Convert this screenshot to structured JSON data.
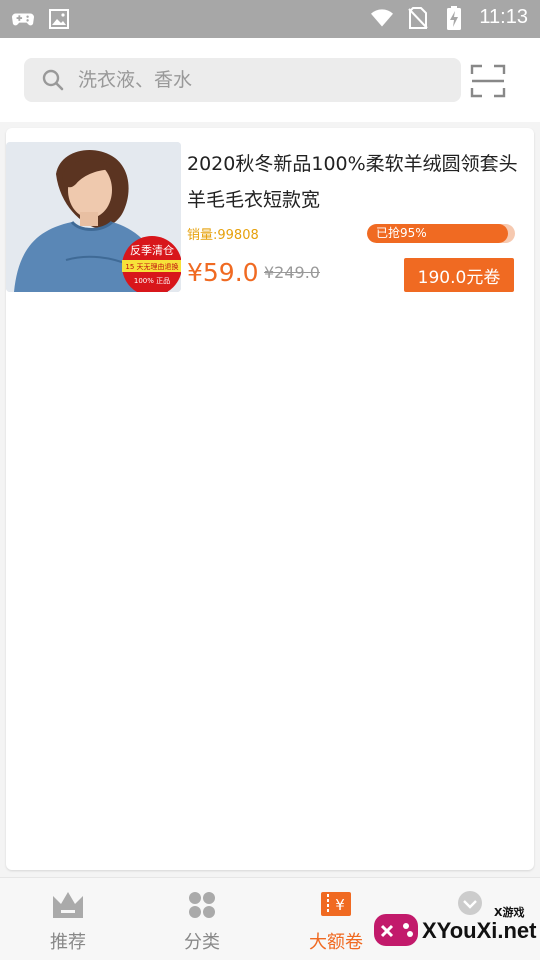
{
  "status_bar": {
    "time": "11:13",
    "icons": [
      "gamepad-icon",
      "image-icon",
      "wifi-icon",
      "no-sim-icon",
      "battery-charging-icon"
    ]
  },
  "search": {
    "placeholder": "洗衣液、香水",
    "scan_icon": "scan-icon"
  },
  "product": {
    "title": "2020秋冬新品100%柔软羊绒圆领套头羊毛毛衣短款宽",
    "sales": "销量:99808",
    "progress_text": "已抢95%",
    "progress_value": 0.95,
    "price": "¥59.0",
    "original_price": "¥249.0",
    "coupon": "190.0元卷",
    "image_badge": {
      "line1": "反季清仓",
      "line2": "15 天无理由退换",
      "line3": "100% 正品"
    }
  },
  "bottom_nav": {
    "items": [
      {
        "label": "推荐",
        "icon": "crown-icon",
        "active": false
      },
      {
        "label": "分类",
        "icon": "grid-icon",
        "active": false
      },
      {
        "label": "大额卷",
        "icon": "coupon-ticket-icon",
        "active": true
      },
      {
        "label": "",
        "icon": "chevron-down-circle-icon",
        "active": false
      }
    ]
  },
  "watermark": {
    "small": "X游戏",
    "big": "XYouXi.net"
  },
  "colors": {
    "accent": "#f06a22",
    "sales_yellow": "#e6a10c",
    "status_bar": "#a7a7a7"
  }
}
